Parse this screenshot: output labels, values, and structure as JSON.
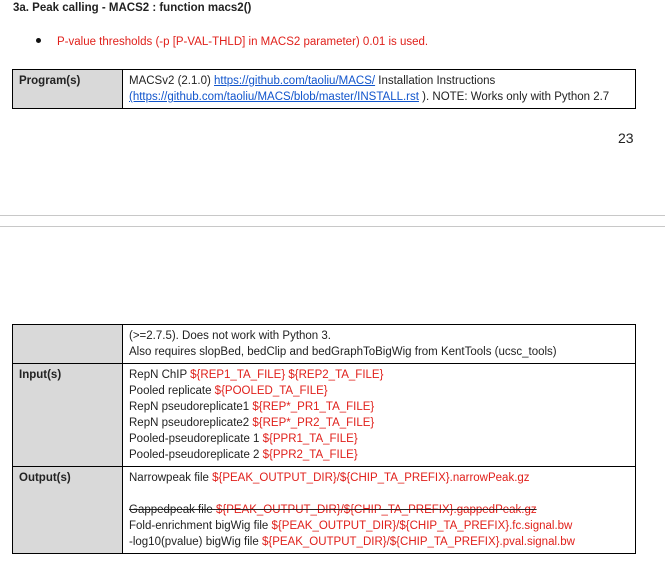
{
  "heading": "3a. Peak calling - MACS2 : function macs2()",
  "bullet": "P-value thresholds (-p [P-VAL-THLD] in MACS2 parameter) 0.01 is used.",
  "program": {
    "label": "Program(s)",
    "prefix": "MACSv2 (2.1.0) ",
    "link1": "https://github.com/taoliu/MACS/",
    "mid": " Installation Instructions",
    "link2": "(https://github.com/taoliu/MACS/blob/master/INSTALL.rst",
    "suffix": " ). NOTE: Works only with Python 2.7"
  },
  "page_number": "23",
  "continued": {
    "line1": "(>=2.7.5). Does not work with Python 3.",
    "line2": "Also requires slopBed, bedClip and bedGraphToBigWig from KentTools (ucsc_tools)"
  },
  "input": {
    "label": "Input(s)",
    "rows": [
      {
        "text": "RepN ChIP ",
        "var": "${REP1_TA_FILE} ${REP2_TA_FILE}"
      },
      {
        "text": "Pooled replicate  ",
        "var": "${POOLED_TA_FILE}"
      },
      {
        "text": "RepN pseudoreplicate1 ",
        "var": "${REP*_PR1_TA_FILE}"
      },
      {
        "text": "RepN pseudoreplicate2  ",
        "var": "${REP*_PR2_TA_FILE}"
      },
      {
        "text": "Pooled-pseudoreplicate 1 ",
        "var": "${PPR1_TA_FILE}"
      },
      {
        "text": "Pooled-pseudoreplicate 2 ",
        "var": "${PPR2_TA_FILE}"
      }
    ]
  },
  "output": {
    "label": "Output(s)",
    "narrow_text": "Narrowpeak file ",
    "narrow_var": "${PEAK_OUTPUT_DIR}/${CHIP_TA_PREFIX}.narrowPeak.gz",
    "gapped_text": "Gappedpeak file ",
    "gapped_var": "${PEAK_OUTPUT_DIR}/${CHIP_TA_PREFIX}.gappedPeak.gz",
    "fc_text": "Fold-enrichment bigWig file ",
    "fc_var": "${PEAK_OUTPUT_DIR}/${CHIP_TA_PREFIX}.fc.signal.bw",
    "pval_text": "-log10(pvalue) bigWig file ",
    "pval_var": "${PEAK_OUTPUT_DIR}/${CHIP_TA_PREFIX}.pval.signal.bw"
  }
}
